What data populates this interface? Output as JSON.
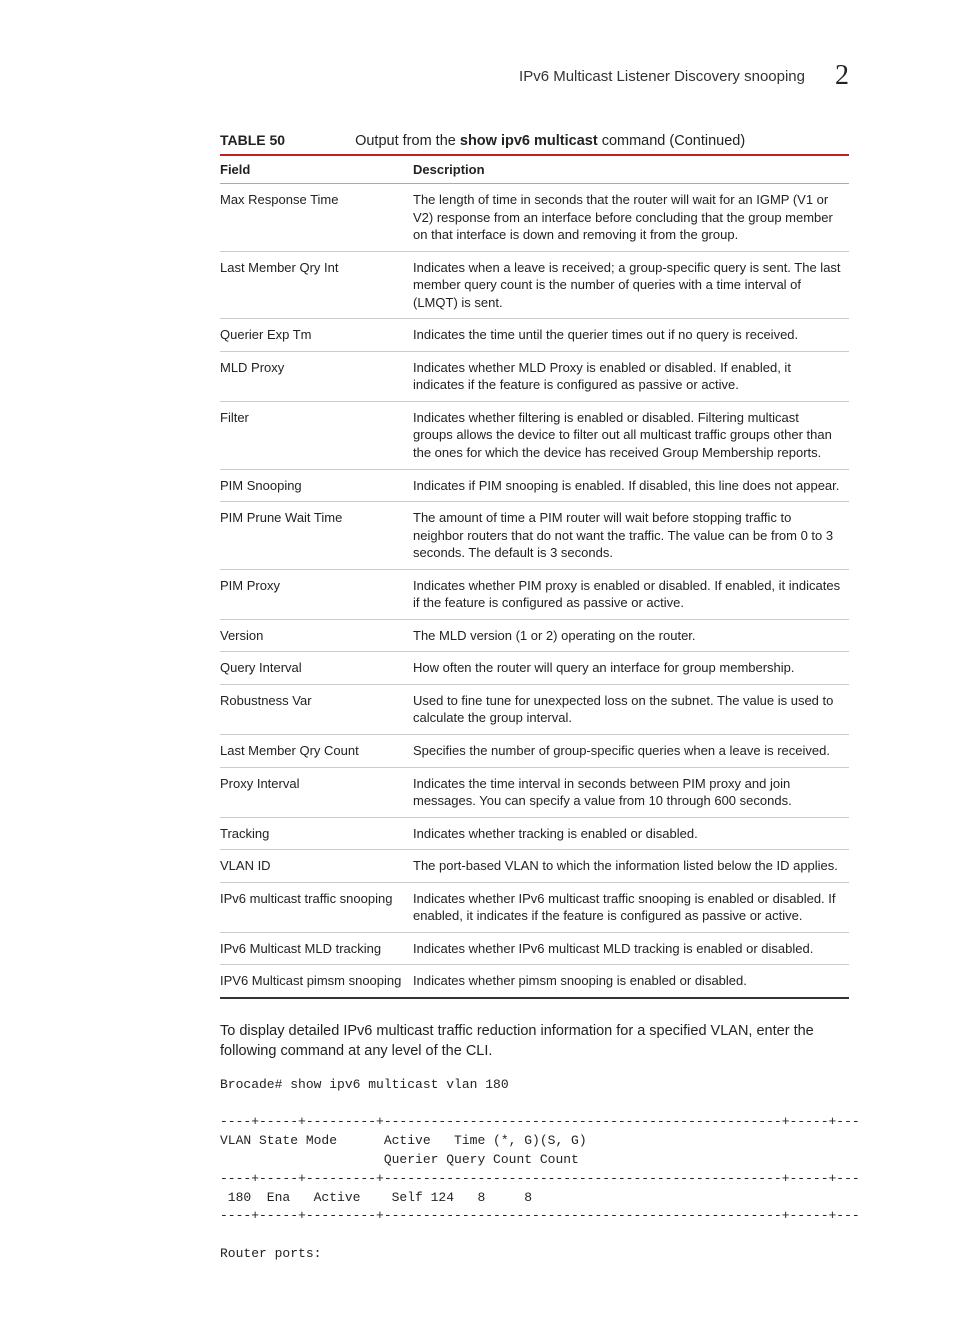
{
  "header": {
    "title": "IPv6 Multicast Listener Discovery snooping",
    "chapter": "2"
  },
  "table": {
    "label": "TABLE 50",
    "caption_prefix": "Output from the ",
    "caption_cmd": "show ipv6 multicast",
    "caption_suffix": " command (Continued)",
    "head_field": "Field",
    "head_desc": "Description",
    "rows": [
      {
        "field": "Max Response Time",
        "desc": "The length of time in seconds that the router will wait for an IGMP (V1 or V2) response from an interface before concluding that the group member on that interface is down and removing it from the group."
      },
      {
        "field": "Last Member Qry Int",
        "desc": "Indicates when a leave is received; a group-specific query is sent. The last member query count is the number of queries with a time interval of (LMQT) is sent."
      },
      {
        "field": "Querier Exp Tm",
        "desc": "Indicates the time until the querier times out if no query is received."
      },
      {
        "field": "MLD Proxy",
        "desc": "Indicates whether MLD Proxy is enabled or disabled. If enabled, it indicates if the feature is configured as passive or active."
      },
      {
        "field": "Filter",
        "desc": "Indicates whether filtering is enabled or disabled. Filtering multicast groups allows the device to filter out all multicast traffic groups other than the ones for which the device has received Group Membership reports."
      },
      {
        "field": "PIM Snooping",
        "desc": "Indicates if PIM snooping is enabled. If disabled, this line does not appear."
      },
      {
        "field": "PIM Prune Wait Time",
        "desc": "The amount of time a PIM router will wait before stopping traffic to neighbor routers that do not want the traffic. The value can be from 0 to 3 seconds. The default is 3 seconds."
      },
      {
        "field": "PIM Proxy",
        "desc": "Indicates whether PIM proxy is enabled or disabled. If enabled, it indicates if the feature is configured as passive or active."
      },
      {
        "field": "Version",
        "desc": "The MLD version (1 or 2) operating on the router."
      },
      {
        "field": "Query Interval",
        "desc": "How often the router will query an interface for group membership."
      },
      {
        "field": "Robustness Var",
        "desc": "Used to fine tune for unexpected loss on the subnet. The value is used to calculate the group interval."
      },
      {
        "field": "Last Member Qry Count",
        "desc": "Specifies the number of group-specific queries when a leave is received."
      },
      {
        "field": "Proxy Interval",
        "desc": "Indicates the time interval in seconds between PIM proxy and join messages. You can specify a value from 10 through 600 seconds."
      },
      {
        "field": "Tracking",
        "desc": "Indicates whether tracking is enabled or disabled."
      },
      {
        "field": "VLAN ID",
        "desc": "The port-based VLAN to which the information listed below the ID applies."
      },
      {
        "field": "IPv6 multicast traffic snooping",
        "desc": "Indicates whether IPv6 multicast traffic snooping is enabled or disabled. If enabled, it indicates if the feature is configured as passive or active."
      },
      {
        "field": "IPv6 Multicast MLD tracking",
        "desc": "Indicates whether IPv6 multicast MLD tracking is enabled or disabled."
      },
      {
        "field": "IPV6 Multicast pimsm snooping",
        "desc": "Indicates whether pimsm snooping is enabled or disabled."
      }
    ]
  },
  "paragraph": "To display detailed IPv6 multicast traffic reduction information for a specified VLAN, enter the following command at any level of the CLI.",
  "terminal": "Brocade# show ipv6 multicast vlan 180\n\n----+-----+---------+---------------------------------------------------+-----+---\nVLAN State Mode      Active   Time (*, G)(S, G)\n                     Querier Query Count Count\n----+-----+---------+---------------------------------------------------+-----+---\n 180  Ena   Active    Self 124   8     8\n----+-----+---------+---------------------------------------------------+-----+---\n\nRouter ports:"
}
